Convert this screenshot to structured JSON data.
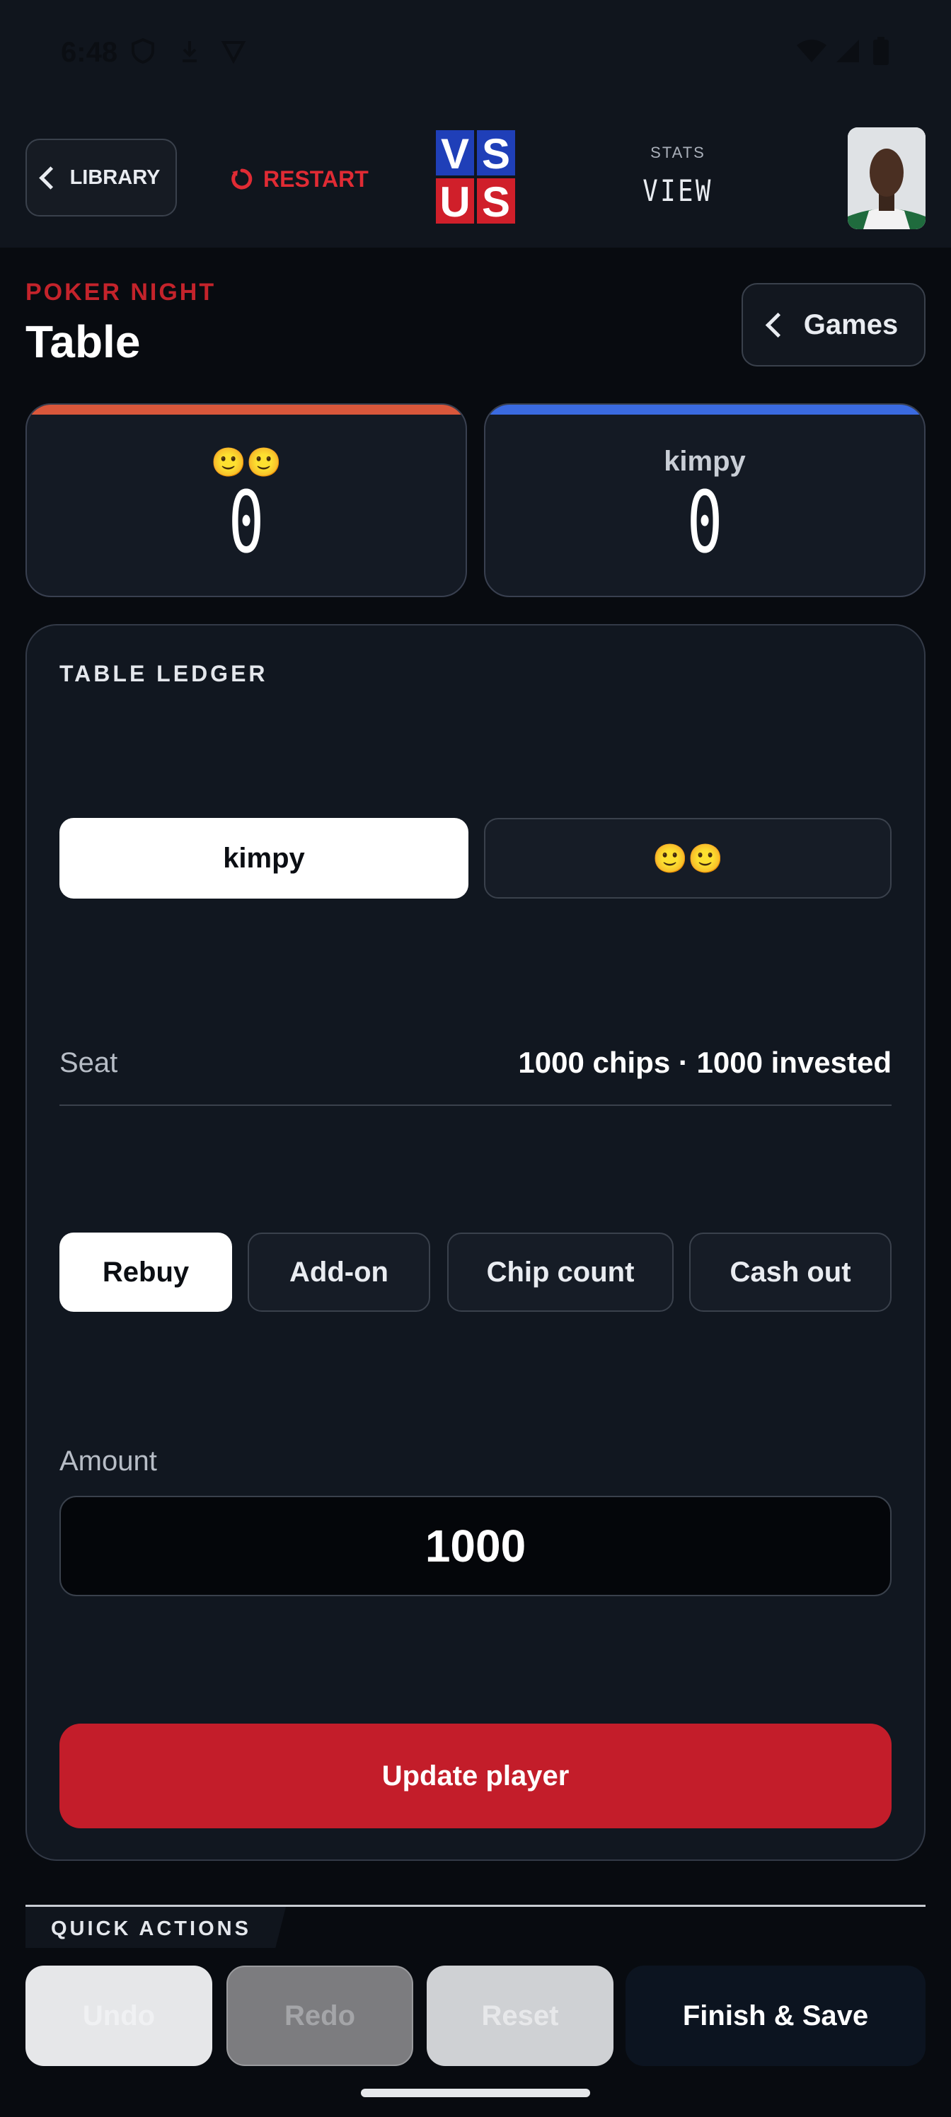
{
  "status_bar": {
    "time": "6:48",
    "icons": [
      "shield-icon",
      "download-icon",
      "vpn-icon",
      "wifi-icon",
      "signal-icon",
      "battery-icon"
    ]
  },
  "nav": {
    "library_label": "LIBRARY",
    "restart_label": "RESTART",
    "logo_text": [
      "V",
      "S",
      "U",
      "S"
    ],
    "stats_label": "STATS",
    "stats_value": "VIEW"
  },
  "header": {
    "eyebrow": "POKER NIGHT",
    "title": "Table",
    "games_label": "Games"
  },
  "scoreboard": [
    {
      "name": "🙂🙂",
      "score": "0",
      "color": "#d9573b"
    },
    {
      "name": "kimpy",
      "score": "0",
      "color": "#3a6ae0"
    }
  ],
  "ledger": {
    "title": "TABLE LEDGER",
    "players": [
      {
        "label": "kimpy",
        "selected": true
      },
      {
        "label": "🙂🙂",
        "selected": false
      }
    ],
    "seat_label": "Seat",
    "seat_value": "1000 chips · 1000 invested",
    "actions": [
      {
        "label": "Rebuy",
        "selected": true
      },
      {
        "label": "Add-on",
        "selected": false
      },
      {
        "label": "Chip count",
        "selected": false
      },
      {
        "label": "Cash out",
        "selected": false
      }
    ],
    "amount_label": "Amount",
    "amount_value": "1000",
    "submit_label": "Update player"
  },
  "quick_actions": {
    "title": "QUICK ACTIONS",
    "buttons": [
      {
        "label": "Undo",
        "enabled": false
      },
      {
        "label": "Redo",
        "enabled": false
      },
      {
        "label": "Reset",
        "enabled": false
      },
      {
        "label": "Finish & Save",
        "enabled": true
      }
    ]
  },
  "colors": {
    "accent_red": "#c31d2a",
    "restart_red": "#e02b34",
    "background": "#080b10",
    "card": "#111720"
  }
}
